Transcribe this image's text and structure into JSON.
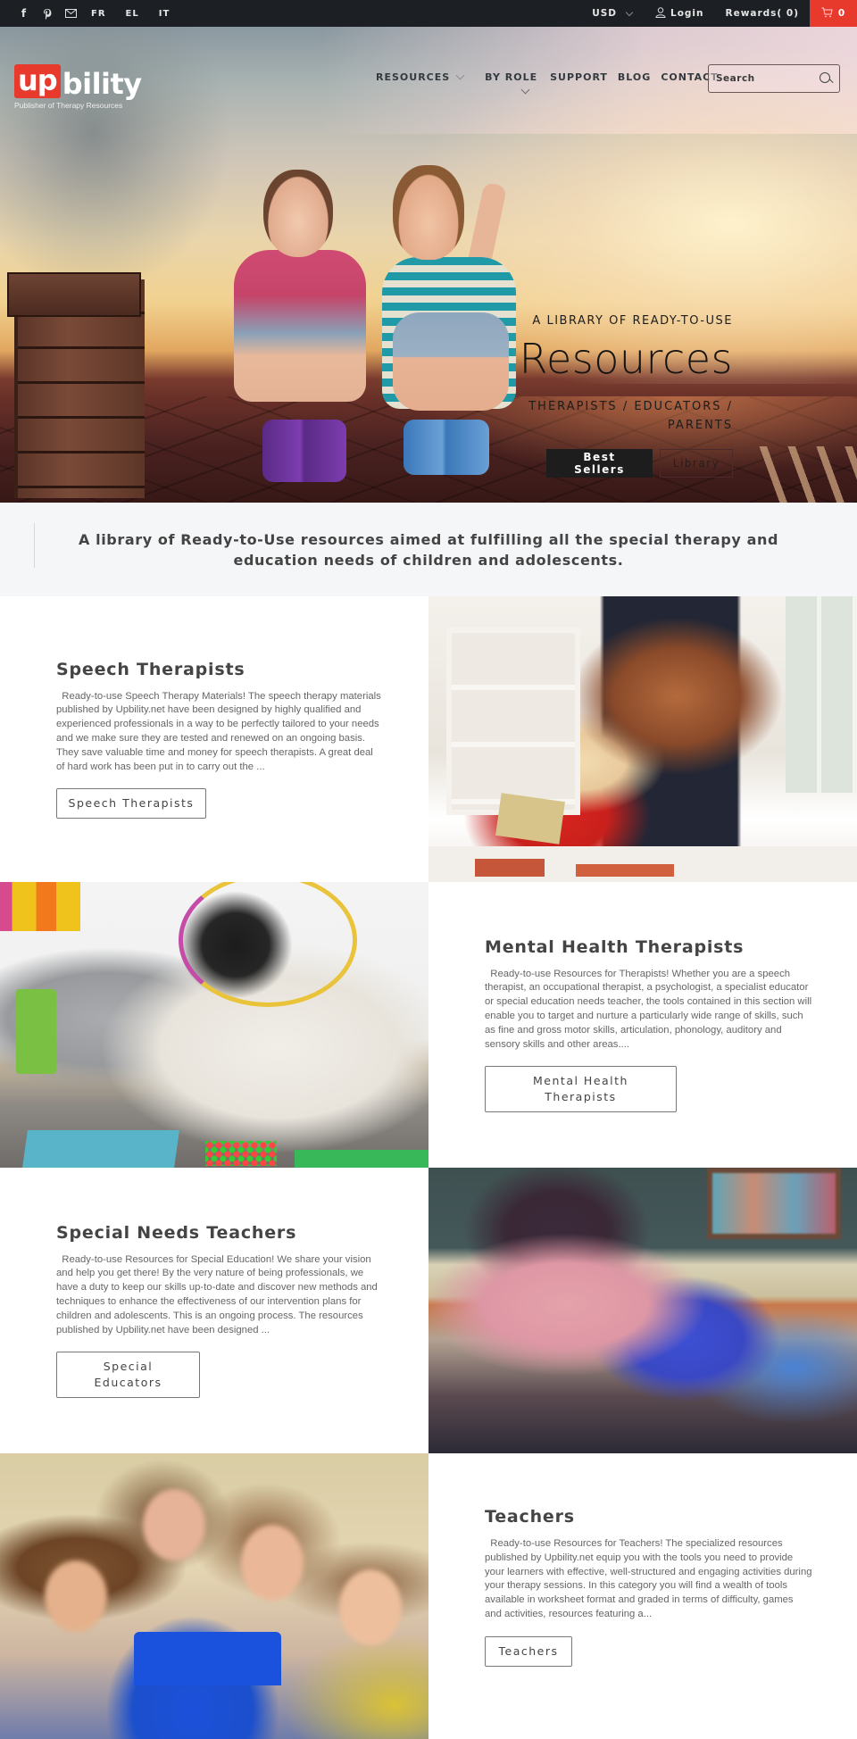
{
  "topbar": {
    "social": [
      {
        "icon": "facebook-icon",
        "glyph": "f"
      },
      {
        "icon": "pinterest-icon",
        "glyph": "P"
      },
      {
        "icon": "email-icon",
        "glyph": "✉"
      }
    ],
    "languages": [
      "FR",
      "EL",
      "IT"
    ],
    "currency": "USD",
    "login_label": "Login",
    "rewards_label": "Rewards( 0)",
    "cart_count": "0",
    "cart_color": "#e8392d"
  },
  "header": {
    "logo_up": "up",
    "logo_bility": "bility",
    "logo_tagline": "Publisher of Therapy Resources",
    "nav": [
      {
        "label": "RESOURCES",
        "has_dropdown": true
      },
      {
        "label": "BY ROLE",
        "has_dropdown": true
      },
      {
        "label": "SUPPORT",
        "has_dropdown": false
      },
      {
        "label": "BLOG",
        "has_dropdown": false
      },
      {
        "label": "CONTACT",
        "has_dropdown": false
      }
    ],
    "search_placeholder": "Search",
    "search_value": ""
  },
  "hero": {
    "subtitle": "A LIBRARY OF READY-TO-USE",
    "title": "Resources",
    "roles": "THERAPISTS / EDUCATORS / PARENTS",
    "buttons": [
      {
        "label": "Best Sellers",
        "style": "dark"
      },
      {
        "label": "Library",
        "style": "outline"
      }
    ]
  },
  "intro": {
    "text": "A library of Ready-to-Use resources aimed at fulfilling all the special therapy and education needs of children and adolescents."
  },
  "sections": [
    {
      "title": "Speech Therapists",
      "text": "Ready-to-use Speech Therapy Materials! The speech therapy materials published by Upbility.net have been designed by highly qualified and experienced professionals in a way to be perfectly tailored to your needs and we make sure they are tested and renewed on an ongoing basis.  They save valuable time and money for speech therapists. A great deal of hard work has been put in to carry out the ...",
      "button": "Speech Therapists",
      "image": "therapist-with-child-photo"
    },
    {
      "title": "Mental Health Therapists",
      "text": "Ready-to-use Resources for Therapists! Whether you are a speech therapist, an occupational therapist, a psychologist, a specialist educator or special education needs teacher, the tools contained in this section will enable you to target and nurture a particularly wide range of skills, such as fine and gross motor skills, articulation, phonology, auditory and sensory skills and other areas....",
      "button": "Mental Health Therapists",
      "image": "therapist-on-floor-with-boy-photo"
    },
    {
      "title": "Special Needs Teachers",
      "text": "Ready-to-use Resources for Special Education! We share your vision and help you get there! By the very nature of being professionals, we have a duty to keep our skills up-to-date and discover new methods and techniques to enhance the effectiveness of our intervention plans for children and adolescents. This is an ongoing process. The resources published by Upbility.net have been designed ...",
      "button": "Special Educators",
      "image": "teacher-with-student-classroom-photo"
    },
    {
      "title": "Teachers",
      "text": "Ready-to-use Resources for Teachers! The specialized resources published by Upbility.net equip you with the tools you need to provide your learners with effective, well-structured and engaging activities during your therapy sessions. In this category you will find a wealth of tools available in worksheet format and graded in terms of difficulty, games and activities, resources featuring a...",
      "button": "Teachers",
      "image": "teacher-with-children-laptop-photo"
    }
  ]
}
